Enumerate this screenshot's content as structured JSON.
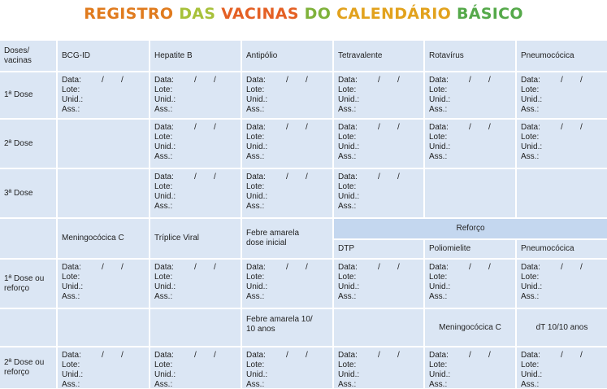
{
  "title": {
    "segments": [
      {
        "text": "REGISTRO ",
        "color": "#e07b1e"
      },
      {
        "text": "DAS ",
        "color": "#a7c13a"
      },
      {
        "text": "VACINAS ",
        "color": "#e46024"
      },
      {
        "text": "DO ",
        "color": "#7fb23b"
      },
      {
        "text": "CALENDÁRIO ",
        "color": "#e2a21d"
      },
      {
        "text": "BÁSICO",
        "color": "#55a94a"
      }
    ]
  },
  "header": {
    "corner": "Doses/\nvacinas",
    "vaccines": [
      "BCG-ID",
      "Hepatite B",
      "Antipólio",
      "Tetravalente",
      "Rotavírus",
      "Pneumocócica"
    ]
  },
  "rows": {
    "dose1": "1ª Dose",
    "dose2": "2ª Dose",
    "dose3": "3ª Dose",
    "dose1_reforco": "1ª Dose ou\nreforço",
    "dose2_reforco": "2ª Dose ou\nreforço"
  },
  "header2": {
    "meningo": "Meningocócica C",
    "triplice": "Tríplice Viral",
    "febre_inicial": "Febre amarela\ndose inicial",
    "reforco": "Reforço",
    "dtp": "DTP",
    "polio": "Poliomielite",
    "pneumo": "Pneumocócica"
  },
  "header3": {
    "febre_10": "Febre amarela 10/\n10 anos",
    "meningo": "Meningocócica C",
    "dt": "dT 10/10 anos"
  },
  "record": {
    "data": "Data:",
    "lote": "Lote:",
    "unid": "Unid.:",
    "ass": "Ass.:",
    "slash": "/"
  }
}
